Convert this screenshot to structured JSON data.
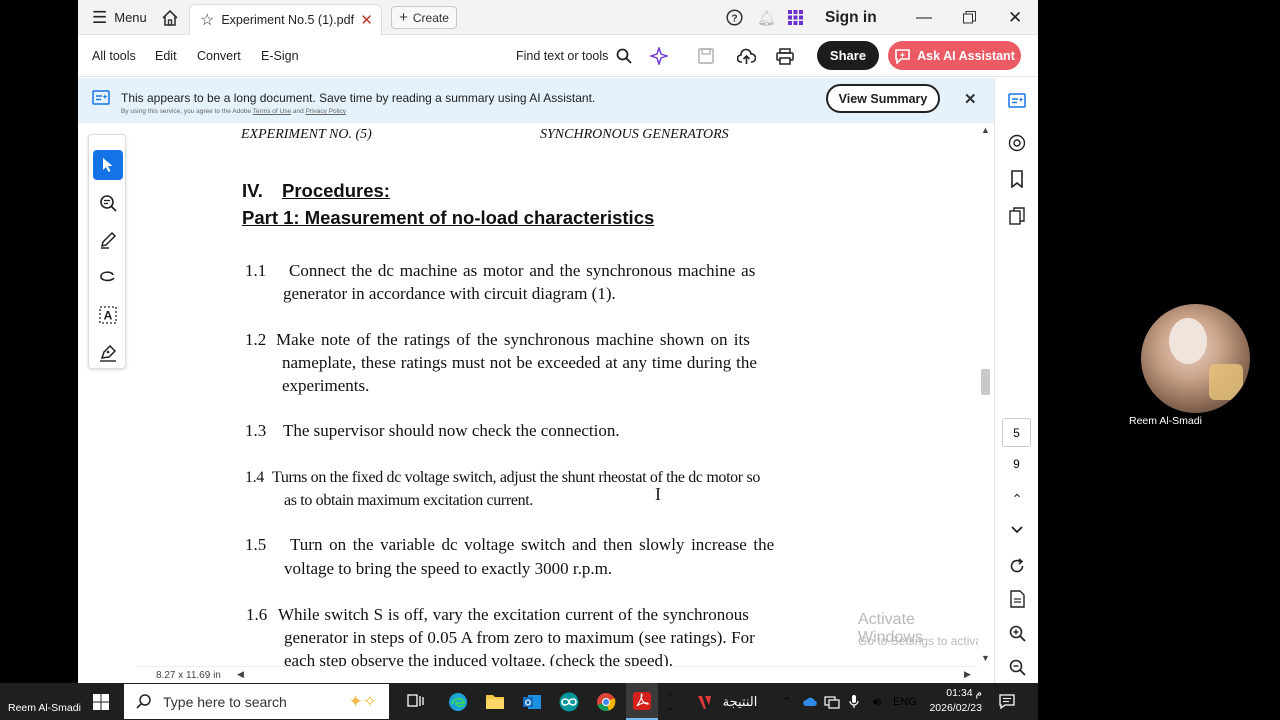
{
  "titlebar": {
    "menu_label": "Menu",
    "tab_title": "Experiment No.5 (1).pdf",
    "create_label": "Create",
    "signin_label": "Sign in"
  },
  "toolbar": {
    "all_tools": "All tools",
    "edit": "Edit",
    "convert": "Convert",
    "esign": "E-Sign",
    "find": "Find text or tools",
    "share": "Share",
    "ask_ai": "Ask AI Assistant"
  },
  "banner": {
    "text": "This appears to be a long document. Save time by reading a summary using AI Assistant.",
    "fine_print_prefix": "By using this service, you agree to the Adobe",
    "terms": "Terms of Use",
    "and": "and",
    "privacy": "Privacy Policy",
    "view_summary": "View Summary"
  },
  "document": {
    "header_left": "EXPERIMENT NO. (5)",
    "header_right": "SYNCHRONOUS GENERATORS",
    "section_num": "IV.",
    "section_title": "Procedures:",
    "part_title": "Part 1: Measurement of no-load characteristics",
    "steps": [
      {
        "num": "1.1",
        "line1": "Connect the dc machine as motor and the synchronous machine as",
        "line2": "generator in accordance with circuit diagram (1)."
      },
      {
        "num": "1.2",
        "line1": "Make note of the ratings of the synchronous machine shown on its",
        "line2": "nameplate, these ratings must not be exceeded at any time during the",
        "line3": "experiments."
      },
      {
        "num": "1.3",
        "line1": "The supervisor should now check the connection."
      },
      {
        "num": "1.4",
        "line1": "Turns on the fixed dc voltage switch, adjust the shunt rheostat of the dc motor so",
        "line2": "as to obtain maximum excitation current."
      },
      {
        "num": "1.5",
        "line1": "Turn on the variable dc voltage switch and then slowly increase the",
        "line2": "voltage to bring the speed to exactly 3000 r.p.m."
      },
      {
        "num": "1.6",
        "line1": "While switch S is off, vary the excitation current of the synchronous",
        "line2": "generator in steps of 0.05 A from zero to maximum (see ratings). For",
        "line3": "each step observe the induced voltage, (check the speed)."
      }
    ]
  },
  "page_size": "8.27 x 11.69 in",
  "pagenav": {
    "current": "5",
    "total": "9"
  },
  "watermark": {
    "line1": "Activate Windows",
    "line2": "Go to Settings to activate Windows."
  },
  "participant": {
    "name": "Reem Al-Smadi"
  },
  "bottom_name": "Reem Al-Smadi",
  "taskbar": {
    "search_placeholder": "Type here to search",
    "arabic_label": "النتيجة",
    "lang": "ENG",
    "time": "01:34 م",
    "date": "2026/02/23"
  },
  "colors": {
    "accent_red": "#ec5b63",
    "accent_blue": "#1473e6",
    "banner_bg": "#e5f1fb"
  }
}
